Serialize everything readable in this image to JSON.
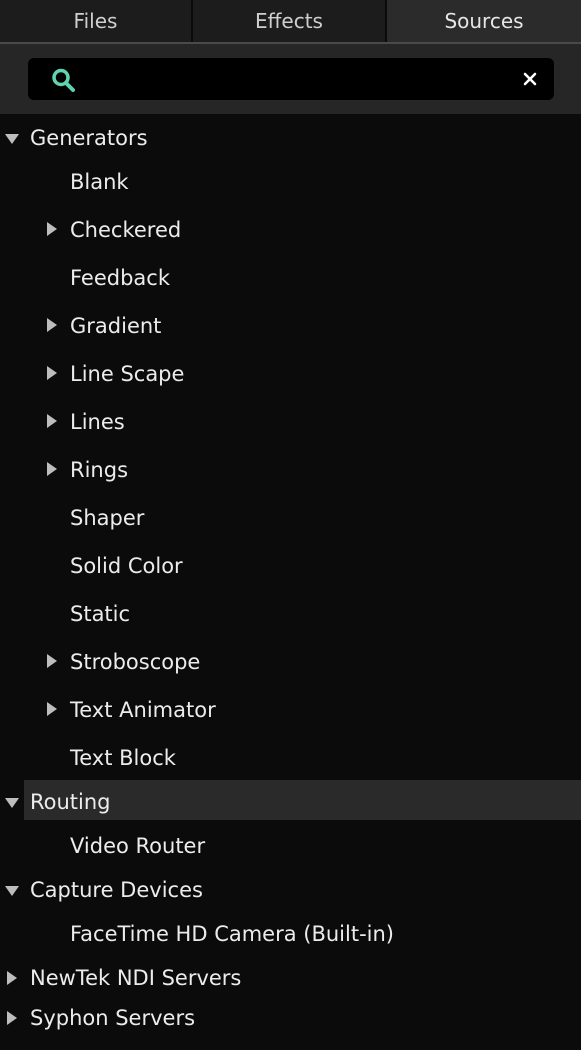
{
  "tabs": [
    {
      "label": "Files",
      "active": false
    },
    {
      "label": "Effects",
      "active": false
    },
    {
      "label": "Sources",
      "active": true
    }
  ],
  "search": {
    "value": "",
    "placeholder": ""
  },
  "tree": {
    "generators": {
      "label": "Generators",
      "items": [
        {
          "label": "Blank",
          "expandable": false
        },
        {
          "label": "Checkered",
          "expandable": true
        },
        {
          "label": "Feedback",
          "expandable": false
        },
        {
          "label": "Gradient",
          "expandable": true
        },
        {
          "label": "Line Scape",
          "expandable": true
        },
        {
          "label": "Lines",
          "expandable": true
        },
        {
          "label": "Rings",
          "expandable": true
        },
        {
          "label": "Shaper",
          "expandable": false
        },
        {
          "label": "Solid Color",
          "expandable": false
        },
        {
          "label": "Static",
          "expandable": false
        },
        {
          "label": "Stroboscope",
          "expandable": true
        },
        {
          "label": "Text Animator",
          "expandable": true
        },
        {
          "label": "Text Block",
          "expandable": false
        }
      ]
    },
    "routing": {
      "label": "Routing",
      "items": [
        {
          "label": "Video Router",
          "expandable": false
        }
      ]
    },
    "capture": {
      "label": "Capture Devices",
      "items": [
        {
          "label": "FaceTime HD Camera (Built-in)",
          "expandable": false
        }
      ]
    },
    "ndi": {
      "label": "NewTek NDI Servers"
    },
    "syphon": {
      "label": "Syphon Servers"
    }
  },
  "colors": {
    "accent": "#5fd3b0",
    "background": "#0b0b0b",
    "selection": "#2a2a2a"
  }
}
